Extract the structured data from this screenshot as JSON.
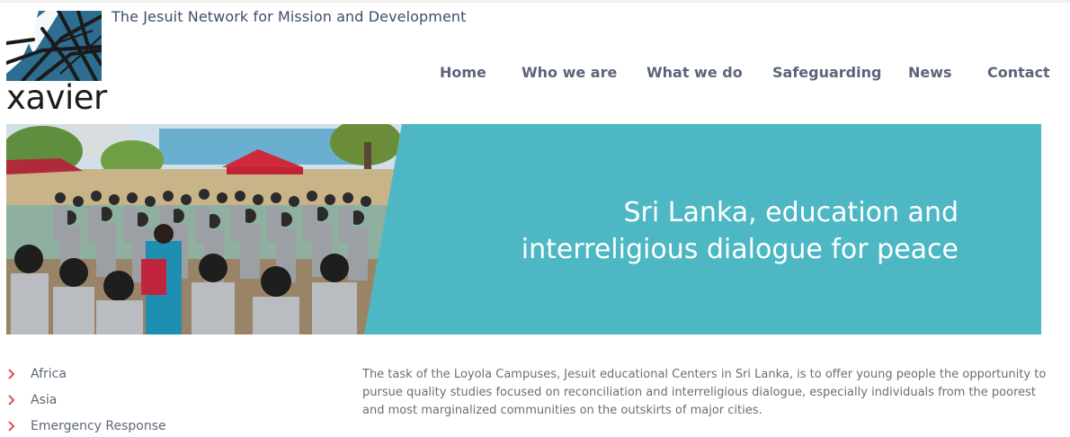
{
  "site": {
    "logo_text": "xavier",
    "tagline": "The Jesuit Network for Mission and Development"
  },
  "nav": {
    "items": [
      {
        "label": "Home"
      },
      {
        "label": "Who we are"
      },
      {
        "label": "What we do"
      },
      {
        "label": "Safeguarding"
      },
      {
        "label": "News"
      },
      {
        "label": "Contact"
      }
    ]
  },
  "hero": {
    "title": "Sri Lanka, education and interreligious dialogue for peace",
    "background_color": "#4db8c3"
  },
  "sidebar": {
    "items": [
      {
        "label": "Africa",
        "icon": "chevron-right-icon"
      },
      {
        "label": "Asia",
        "icon": "chevron-right-icon"
      },
      {
        "label": "Emergency Response",
        "icon": "chevron-right-icon"
      }
    ],
    "chevron_color": "#d9534f"
  },
  "article": {
    "body": "The task of the Loyola Campuses, Jesuit educational Centers in Sri Lanka, is to offer young people the opportunity to pursue quality studies focused on reconciliation and interreligious dialogue, especially individuals from the poorest and most marginalized communities on the outskirts of major cities."
  }
}
